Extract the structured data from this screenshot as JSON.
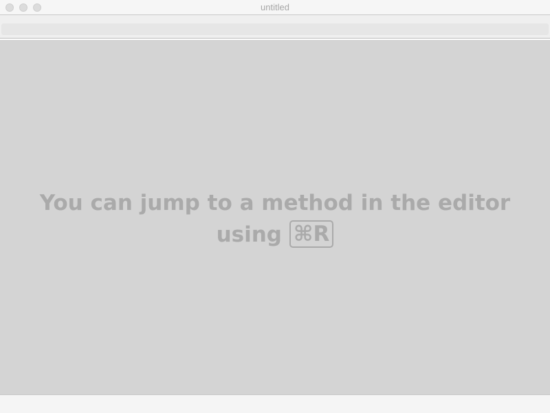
{
  "window": {
    "title": "untitled"
  },
  "hint": {
    "line1": "You can jump to a method in the editor",
    "line2": "using",
    "shortcut": "⌘R"
  },
  "colors": {
    "background": "#d4d4d4",
    "hint_text": "#aaaaaa",
    "titlebar": "#f6f6f6"
  }
}
